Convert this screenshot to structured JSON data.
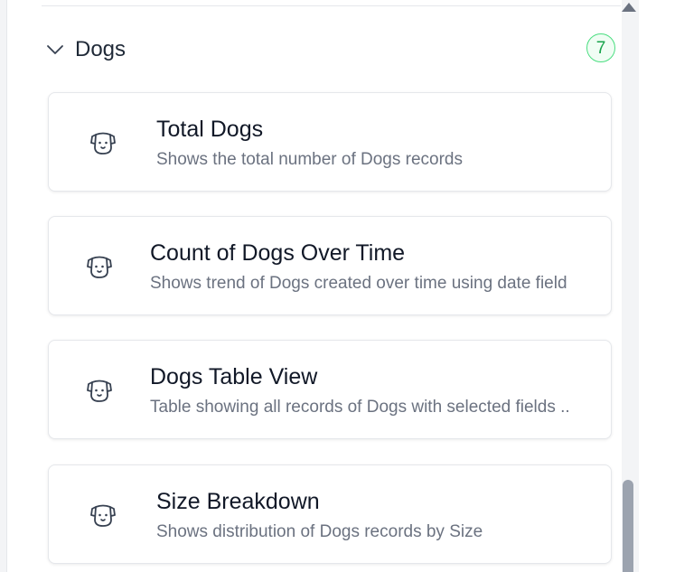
{
  "section": {
    "title": "Dogs",
    "count": "7",
    "accent_color": "#16a34a"
  },
  "cards": [
    {
      "title": "Total Dogs",
      "description": "Shows the total number of Dogs records",
      "icon": "dog-icon"
    },
    {
      "title": "Count of Dogs Over Time",
      "description": "Shows trend of Dogs created over time using date field",
      "icon": "dog-icon"
    },
    {
      "title": "Dogs Table View",
      "description": "Table showing all records of Dogs with selected fields ..",
      "icon": "dog-icon"
    },
    {
      "title": "Size Breakdown",
      "description": "Shows distribution of Dogs records by Size",
      "icon": "dog-icon"
    }
  ]
}
